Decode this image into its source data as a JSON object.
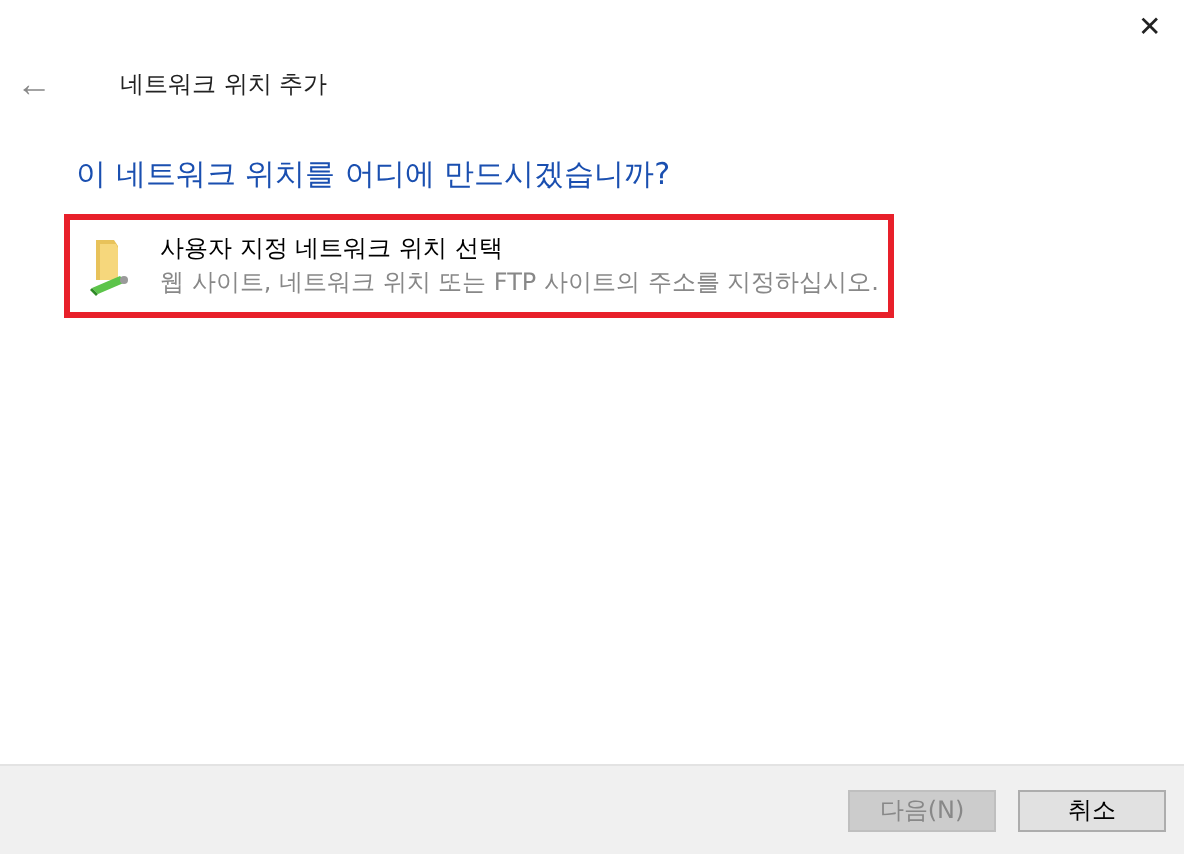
{
  "window": {
    "close": "✕"
  },
  "header": {
    "back": "←",
    "title": "네트워크 위치 추가"
  },
  "heading": "이 네트워크 위치를 어디에 만드시겠습니까?",
  "options": [
    {
      "title": "사용자 지정 네트워크 위치 선택",
      "description": "웹 사이트, 네트워크 위치 또는 FTP 사이트의 주소를 지정하십시오.",
      "highlighted": true
    }
  ],
  "buttons": [
    {
      "label": "다음(N)",
      "disabled": true
    },
    {
      "label": "취소",
      "disabled": false
    }
  ]
}
